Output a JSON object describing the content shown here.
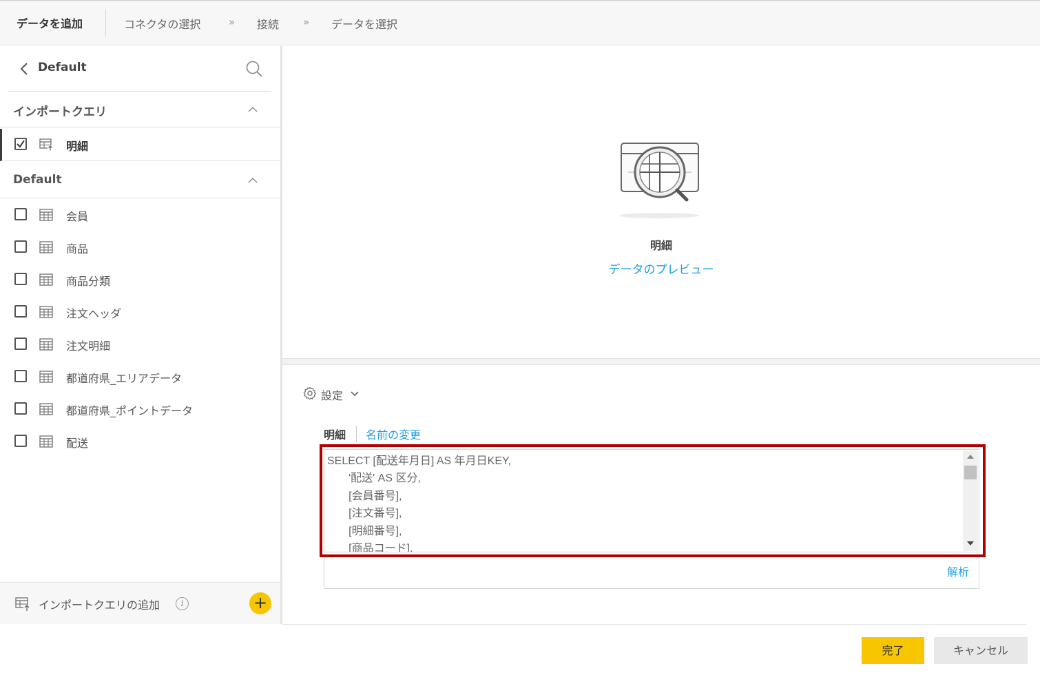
{
  "header": {
    "title": "データを追加",
    "breadcrumbs": [
      "コネクタの選択",
      "接続",
      "データを選択"
    ],
    "separator": "»"
  },
  "sidebar": {
    "connection_name": "Default",
    "import_section": {
      "label": "インポートクエリ",
      "items": [
        {
          "label": "明細",
          "checked": true
        }
      ]
    },
    "default_section": {
      "label": "Default",
      "items": [
        {
          "label": "会員",
          "checked": false
        },
        {
          "label": "商品",
          "checked": false
        },
        {
          "label": "商品分類",
          "checked": false
        },
        {
          "label": "注文ヘッダ",
          "checked": false
        },
        {
          "label": "注文明細",
          "checked": false
        },
        {
          "label": "都道府県_エリアデータ",
          "checked": false
        },
        {
          "label": "都道府県_ポイントデータ",
          "checked": false
        },
        {
          "label": "配送",
          "checked": false
        }
      ]
    },
    "footer": {
      "label": "インポートクエリの追加",
      "info": "i",
      "add": "+"
    }
  },
  "preview": {
    "title": "明細",
    "link": "データのプレビュー"
  },
  "settings": {
    "label": "設定",
    "tab_active": "明細",
    "tab_rename": "名前の変更",
    "sql": "SELECT [配送年月日] AS 年月日KEY,\n       '配送' AS 区分,\n       [会員番号],\n       [注文番号],\n       [明細番号],\n       [商品コード],",
    "parse": "解析"
  },
  "actions": {
    "done": "完了",
    "cancel": "キャンセル"
  },
  "colors": {
    "accent_yellow": "#f7c600",
    "link_blue": "#1ea0e0",
    "highlight_red": "#b00000"
  }
}
